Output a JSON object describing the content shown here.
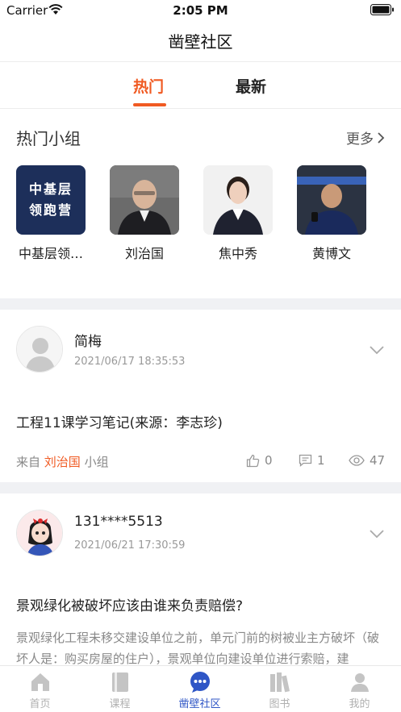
{
  "status_bar": {
    "carrier": "Carrier",
    "time": "2:05 PM"
  },
  "nav": {
    "title": "凿壁社区"
  },
  "tabs": {
    "hot": "热门",
    "latest": "最新",
    "active": "hot"
  },
  "hot_groups": {
    "title": "热门小组",
    "more": "更多",
    "items": [
      {
        "name": "中基层领…",
        "logo_line1": "中基层",
        "logo_line2": "领跑营"
      },
      {
        "name": "刘治国"
      },
      {
        "name": "焦中秀"
      },
      {
        "name": "黄博文"
      }
    ]
  },
  "posts": [
    {
      "author": "简梅",
      "time": "2021/06/17 18:35:53",
      "title": "工程11课学习笔记(来源：李志珍)",
      "from_prefix": "来自",
      "from_group": "刘治国",
      "from_suffix": "小组",
      "likes": "0",
      "comments": "1",
      "views": "47"
    },
    {
      "author": "131****5513",
      "time": "2021/06/21 17:30:59",
      "title": "景观绿化被破坏应该由谁来负责赔偿?",
      "body": "景观绿化工程未移交建设单位之前，单元门前的树被业主方破坏（破坏人是：购买房屋的住户），景观单位向建设单位进行索赔，建"
    }
  ],
  "tabbar": [
    {
      "label": "首页",
      "icon": "home-icon"
    },
    {
      "label": "课程",
      "icon": "course-book-icon"
    },
    {
      "label": "凿壁社区",
      "icon": "chat-bubble-icon",
      "active": true
    },
    {
      "label": "图书",
      "icon": "books-icon"
    },
    {
      "label": "我的",
      "icon": "user-icon"
    }
  ],
  "colors": {
    "accent": "#f05a22",
    "active_tab": "#2f56c6",
    "muted": "#888888",
    "gap": "#f0f1f4"
  }
}
